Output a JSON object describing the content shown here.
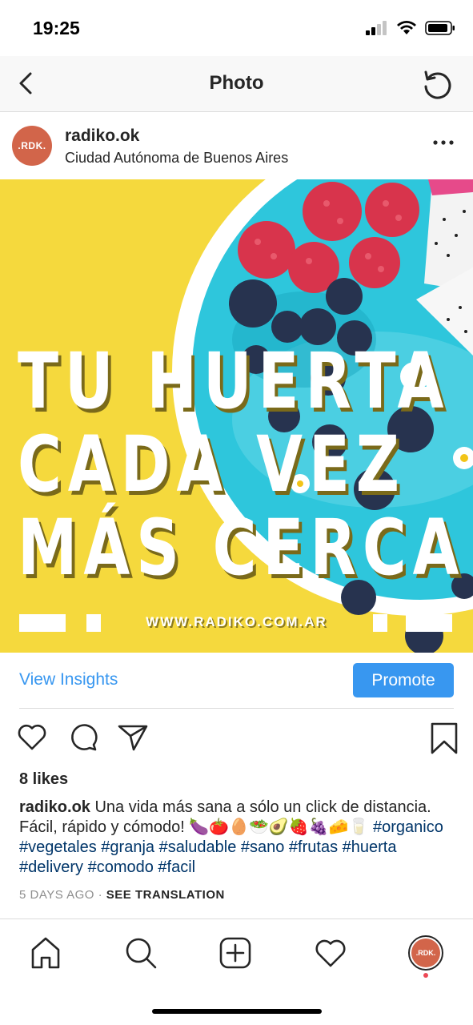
{
  "status_bar": {
    "time": "19:25"
  },
  "nav": {
    "title": "Photo"
  },
  "post": {
    "avatar_text": ".RDK.",
    "username": "radiko.ok",
    "location": "Ciudad Autónoma de Buenos Aires",
    "image": {
      "headline_lines": [
        "TU HUERTA",
        "CADA VEZ",
        "MÁS CERCA"
      ],
      "url_text": "WWW.RADIKO.COM.AR"
    }
  },
  "insights": {
    "view_label": "View Insights",
    "promote_label": "Promote"
  },
  "likes": "8 likes",
  "caption": {
    "user": "radiko.ok",
    "text": " Una vida más sana a sólo un click de distancia. Fácil, rápido y cómodo! 🍆🍅🥚🥗🥑🍓🍇🧀🥛 ",
    "hashtags": "#organico #vegetales #granja #saludable #sano #frutas #huerta #delivery #comodo #facil"
  },
  "meta": {
    "time_ago": "5 DAYS AGO",
    "separator": " · ",
    "see_translation": "SEE TRANSLATION"
  },
  "tab_bar": {
    "avatar_text": ".RDK."
  },
  "colors": {
    "accent": "#3897f0",
    "hashtag": "#003569",
    "muted": "#8e8e8e",
    "photo_background": "#f5d93d",
    "bowl": "#2ec6dc"
  },
  "icons": {
    "status": [
      "signal-icon",
      "wifi-icon",
      "battery-icon"
    ],
    "nav": [
      "back-icon",
      "refresh-icon"
    ],
    "post": [
      "more-icon"
    ],
    "actions": [
      "heart-icon",
      "comment-icon",
      "share-icon",
      "bookmark-icon"
    ],
    "tabs": [
      "home-icon",
      "search-icon",
      "add-icon",
      "activity-icon",
      "profile-icon"
    ]
  }
}
